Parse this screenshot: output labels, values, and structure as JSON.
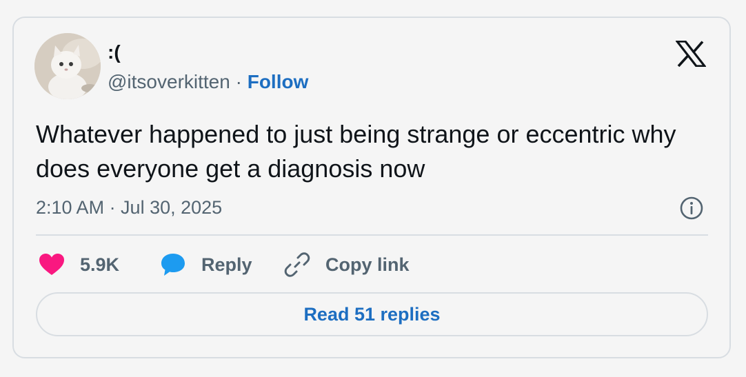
{
  "author": {
    "display_name": ":(",
    "handle": "@itsoverkitten",
    "separator": "·",
    "follow_label": "Follow",
    "avatar_icon": "kitten-avatar"
  },
  "brand": {
    "logo_icon": "x-logo-icon"
  },
  "tweet": {
    "text": "Whatever happened to just being strange or eccentric why does everyone get a diagnosis now",
    "timestamp": "2:10 AM · Jul 30, 2025"
  },
  "actions": {
    "like_count": "5.9K",
    "reply_label": "Reply",
    "copy_link_label": "Copy link"
  },
  "footer": {
    "read_replies_label": "Read 51 replies"
  },
  "colors": {
    "link_blue": "#1d6ec1",
    "heart_pink": "#f91880",
    "reply_blue": "#1d9bf0",
    "text_primary": "#0f1419",
    "text_secondary": "#536471",
    "border": "#d8dde2",
    "background": "#f5f5f5"
  }
}
